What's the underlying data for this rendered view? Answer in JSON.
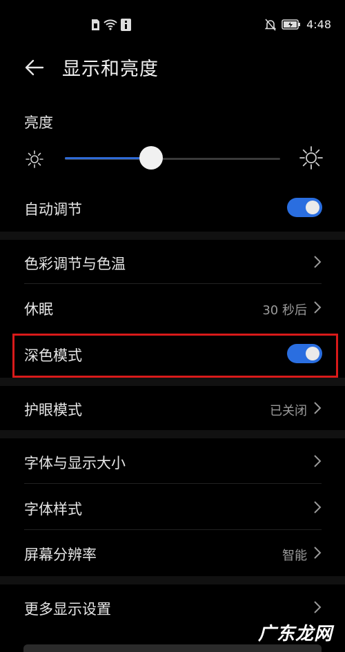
{
  "status_bar": {
    "time": "4:48"
  },
  "header": {
    "title": "显示和亮度"
  },
  "brightness": {
    "label": "亮度",
    "level": 0.4
  },
  "rows": {
    "auto_adjust": {
      "label": "自动调节",
      "on": true
    },
    "color": {
      "label": "色彩调节与色温"
    },
    "sleep": {
      "label": "休眠",
      "value": "30 秒后"
    },
    "dark_mode": {
      "label": "深色模式",
      "on": true
    },
    "eye_comfort": {
      "label": "护眼模式",
      "value": "已关闭"
    },
    "font_size": {
      "label": "字体与显示大小"
    },
    "font_style": {
      "label": "字体样式"
    },
    "resolution": {
      "label": "屏幕分辨率",
      "value": "智能"
    },
    "more": {
      "label": "更多显示设置"
    }
  },
  "watermark": "广东龙网",
  "colors": {
    "accent": "#2a6ee0",
    "highlight": "#d91a1a",
    "background": "#000000"
  }
}
